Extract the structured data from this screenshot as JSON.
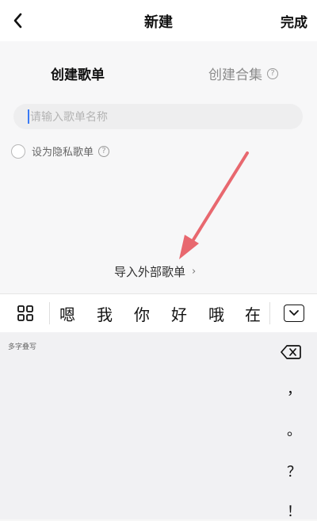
{
  "header": {
    "title": "新建",
    "done_label": "完成"
  },
  "tabs": {
    "create_playlist": "创建歌单",
    "create_collection": "创建合集",
    "help_glyph": "?"
  },
  "form": {
    "name_placeholder": "请输入歌单名称",
    "private_label": "设为隐私歌单",
    "private_checked": false,
    "help_glyph": "?"
  },
  "import_link": {
    "label": "导入外部歌单",
    "chevron": "›"
  },
  "annotation": {
    "arrow_color": "#e8686f"
  },
  "keyboard": {
    "candidates": [
      "嗯",
      "我",
      "你",
      "好",
      "哦",
      "在"
    ],
    "handwriting_label": "多字叠写",
    "punctuation": [
      "，",
      "。",
      "？",
      "！"
    ]
  },
  "icons": [
    "back-arrow-icon",
    "help-icon",
    "grid-icon",
    "collapse-keyboard-icon",
    "backspace-icon"
  ]
}
